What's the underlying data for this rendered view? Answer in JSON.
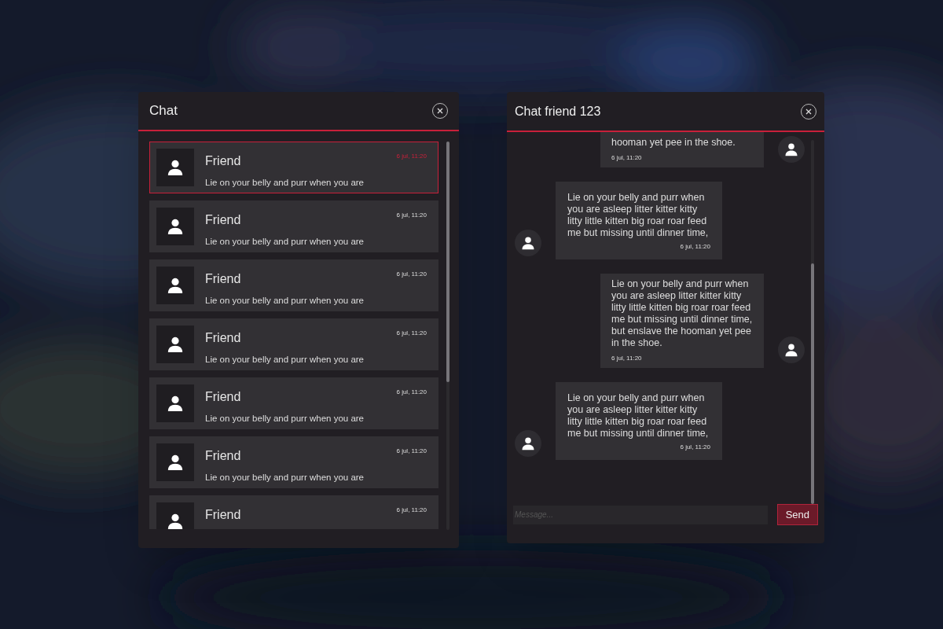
{
  "chat_list": {
    "title": "Chat",
    "items": [
      {
        "name": "Friend",
        "preview": "Lie on your belly and purr when you are",
        "time": "6 jul, 11:20",
        "selected": true
      },
      {
        "name": "Friend",
        "preview": "Lie on your belly and purr when you are",
        "time": "6 jul, 11:20",
        "selected": false
      },
      {
        "name": "Friend",
        "preview": "Lie on your belly and purr when you are",
        "time": "6 jul, 11:20",
        "selected": false
      },
      {
        "name": "Friend",
        "preview": "Lie on your belly and purr when you are",
        "time": "6 jul, 11:20",
        "selected": false
      },
      {
        "name": "Friend",
        "preview": "Lie on your belly and purr when you are",
        "time": "6 jul, 11:20",
        "selected": false
      },
      {
        "name": "Friend",
        "preview": "Lie on your belly and purr when you are",
        "time": "6 jul, 11:20",
        "selected": false
      },
      {
        "name": "Friend",
        "time": "6 jul, 11:20",
        "selected": false
      }
    ]
  },
  "conversation": {
    "title": "Chat friend 123",
    "messages": [
      {
        "kind": "sent",
        "text": "hooman yet pee in the shoe.",
        "time": "6 jul, 11:20"
      },
      {
        "kind": "received",
        "text": "Lie on your belly and purr when you are asleep litter kitter kitty litty little kitten big roar roar feed me but missing until dinner time,",
        "time": "6 jul, 11:20"
      },
      {
        "kind": "sent",
        "text": "Lie on your belly and purr when you are asleep litter kitter kitty litty little kitten big roar roar feed me but missing until dinner time, but enslave the hooman yet pee in the shoe.",
        "time": "6 jul, 11:20"
      },
      {
        "kind": "received",
        "text": "Lie on your belly and purr when you are asleep litter kitter kitty litty little kitten big roar roar feed me but missing until dinner time,",
        "time": "6 jul, 11:20"
      }
    ],
    "composer": {
      "placeholder": "Message...",
      "send_label": "Send"
    }
  }
}
